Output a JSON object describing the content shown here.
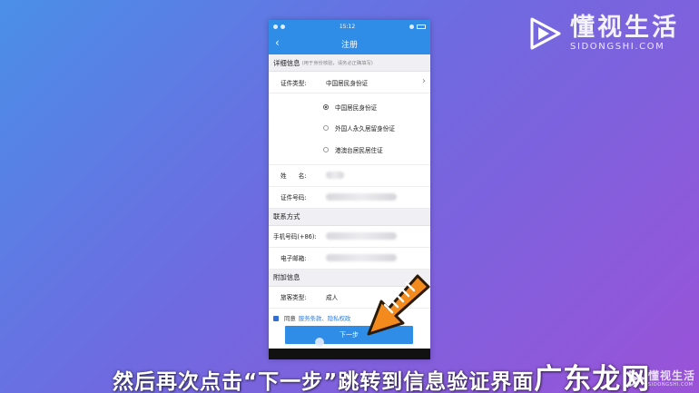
{
  "brand": {
    "name": "懂视生活",
    "url": "SIDONGSHI.COM"
  },
  "status": {
    "time": "15:12"
  },
  "nav": {
    "title": "注册",
    "back": "‹"
  },
  "details": {
    "header": "详细信息",
    "hint": "(用于身份核验，请务必正确填写)",
    "id_type_label": "证件类型:",
    "id_type_value": "中国居民身份证",
    "options": [
      "中国居民身份证",
      "外国人永久居留身份证",
      "港澳台居民居住证"
    ],
    "selected_option": 0,
    "name_label": "姓　　名:",
    "id_number_label": "证件号码:"
  },
  "contact": {
    "header": "联系方式",
    "phone_label": "手机号码(+86):",
    "email_label": "电子邮箱:"
  },
  "extra": {
    "header": "附加信息",
    "passenger_type_label": "旅客类型:",
    "passenger_type_value": "成人"
  },
  "agree": {
    "text": "同意",
    "links": "服务条款、隐私权政"
  },
  "next_button": "下一步",
  "caption": {
    "text": "然后再次点击“下一步”跳转到信息验证界面",
    "tail": "广东龙网"
  },
  "watermark": {
    "name": "懂视生活",
    "url": "SIDONGSHI.COM"
  },
  "colors": {
    "primary": "#2f8de8",
    "arrow": "#f28a1e",
    "link": "#2f7fe0"
  }
}
